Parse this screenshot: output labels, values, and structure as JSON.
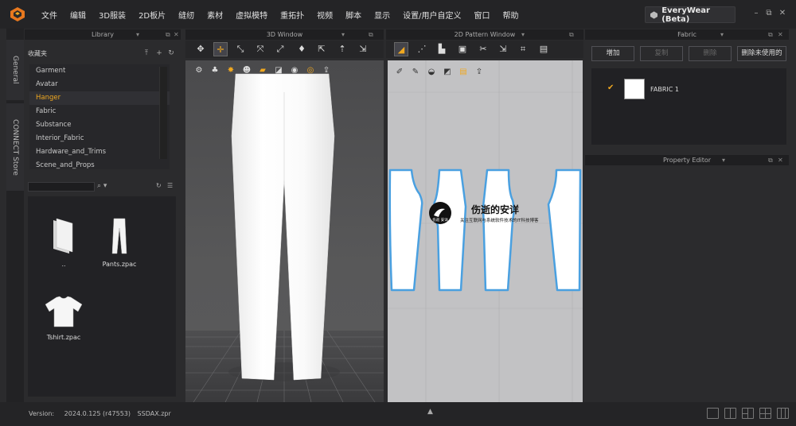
{
  "menu": [
    "文件",
    "编辑",
    "3D服装",
    "2D板片",
    "缝纫",
    "素材",
    "虚拟模特",
    "重拓扑",
    "视频",
    "脚本",
    "显示",
    "设置/用户自定义",
    "窗口",
    "帮助"
  ],
  "brand": "EveryWear (Beta)",
  "window_controls": {
    "minimize": "–",
    "restore": "⧉",
    "close": "✕"
  },
  "side_tabs": [
    "General",
    "CONNECT Store"
  ],
  "library": {
    "title": "Library",
    "favorites": "收藏夹",
    "tree": [
      "Garment",
      "Avatar",
      "Hanger",
      "Fabric",
      "Substance",
      "Interior_Fabric",
      "Hardware_and_Trims",
      "Scene_and_Props"
    ],
    "selected": "Hanger",
    "files": [
      {
        "name": "..",
        "icon": "folder-icon"
      },
      {
        "name": "Pants.zpac",
        "icon": "pants-icon"
      },
      {
        "name": "Tshirt.zpac",
        "icon": "tshirt-icon"
      }
    ]
  },
  "window3d": {
    "title": "3D Window"
  },
  "window2d": {
    "title": "2D Pattern Window"
  },
  "fabric": {
    "title": "Fabric",
    "buttons": [
      "增加",
      "复制",
      "删除",
      "删除未使用的"
    ],
    "item": "FABRIC 1",
    "swatch_color": "#ffffff"
  },
  "property_editor": {
    "title": "Property Editor"
  },
  "watermark": {
    "title": "伤逝的安详",
    "subtitle": "关注互联网与系统软件技术的IT科技博客",
    "logo_text": "伤逝 安详"
  },
  "status": {
    "version_label": "Version:",
    "version_value": "2024.0.125 (r47553)",
    "file": "SSDAX.zpr"
  },
  "colors": {
    "accent": "#f0a820",
    "pattern_outline": "#4aa0e0"
  }
}
